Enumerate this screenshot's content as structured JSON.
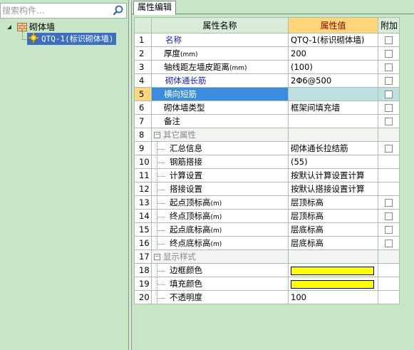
{
  "left": {
    "search_placeholder": "搜索构件...",
    "tree": {
      "root_label": "砌体墙",
      "child_label": "QTQ-1(标识砌体墙)"
    }
  },
  "right": {
    "tab_label": "属性编辑",
    "grid": {
      "headers": {
        "name": "属性名称",
        "value": "属性值",
        "add": "附加"
      },
      "rows": [
        {
          "num": "1",
          "name": "名称",
          "value": "QTQ-1(标识砌体墙)"
        },
        {
          "num": "2",
          "name": "厚度",
          "unit": "(mm)",
          "value": "200"
        },
        {
          "num": "3",
          "name": "轴线距左墙皮距离",
          "unit": "(mm)",
          "value": "(100)"
        },
        {
          "num": "4",
          "name": "砌体通长筋",
          "value": "2Φ6@500"
        },
        {
          "num": "5",
          "name": "横向短筋",
          "value": ""
        },
        {
          "num": "6",
          "name": "砌体墙类型",
          "value": "框架间填充墙"
        },
        {
          "num": "7",
          "name": "备注",
          "value": ""
        },
        {
          "num": "8",
          "name": "其它属性",
          "value": ""
        },
        {
          "num": "9",
          "name": "汇总信息",
          "value": "砌体通长拉结筋"
        },
        {
          "num": "10",
          "name": "钢筋搭接",
          "value": "(55)"
        },
        {
          "num": "11",
          "name": "计算设置",
          "value": "按默认计算设置计算"
        },
        {
          "num": "12",
          "name": "搭接设置",
          "value": "按默认搭接设置计算"
        },
        {
          "num": "13",
          "name": "起点顶标高",
          "unit": "(m)",
          "value": "层顶标高"
        },
        {
          "num": "14",
          "name": "终点顶标高",
          "unit": "(m)",
          "value": "层顶标高"
        },
        {
          "num": "15",
          "name": "起点底标高",
          "unit": "(m)",
          "value": "层底标高"
        },
        {
          "num": "16",
          "name": "终点底标高",
          "unit": "(m)",
          "value": "层底标高"
        },
        {
          "num": "17",
          "name": "显示样式",
          "value": ""
        },
        {
          "num": "18",
          "name": "边框颜色",
          "value": ""
        },
        {
          "num": "19",
          "name": "填充颜色",
          "value": ""
        },
        {
          "num": "20",
          "name": "不透明度",
          "value": "100"
        }
      ]
    }
  },
  "colors": {
    "background": "#c6e6c6",
    "selection": "#3a8de0",
    "value_header": "#ffd77a",
    "swatch": "#ffff00",
    "blue_text": "#1a22cc"
  }
}
